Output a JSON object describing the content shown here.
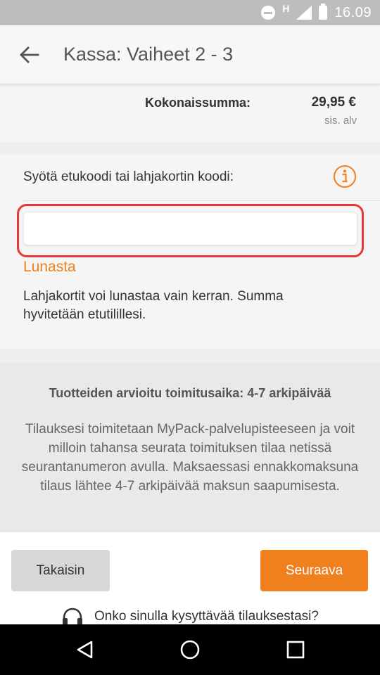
{
  "status_bar": {
    "time": "16.09",
    "network_label": "H",
    "icons": [
      "do-not-disturb-icon",
      "signal-icon",
      "battery-icon"
    ]
  },
  "toolbar": {
    "title": "Kassa: Vaiheet 2 - 3",
    "back_icon": "arrow-left-icon"
  },
  "summary": {
    "total_label": "Kokonaissumma:",
    "total_value": "29,95 €",
    "vat_note": "sis. alv"
  },
  "voucher": {
    "label": "Syötä etukoodi tai lahjakortin koodi:",
    "input_value": "",
    "input_placeholder": "",
    "redeem_label": "Lunasta",
    "note": "Lahjakortit voi lunastaa vain kerran. Summa hyvitetään etutilillesi.",
    "info_icon": "info-icon"
  },
  "delivery": {
    "title": "Tuotteiden arvioitu toimitusaika: 4-7 arkipäivää",
    "text": "Tilauksesi toimitetaan MyPack-palvelupisteeseen ja voit milloin tahansa seurata toimituksen tilaa netissä seurantanumeron avulla. Maksaessasi ennakkomaksuna tilaus lähtee 4-7 arkipäivää maksun saapumisesta."
  },
  "actions": {
    "back_label": "Takaisin",
    "next_label": "Seuraava"
  },
  "help": {
    "text": "Onko sinulla kysyttävää tilauksestasi?",
    "icon": "headset-icon"
  },
  "colors": {
    "accent": "#f07f1e",
    "highlight": "#e53935",
    "status_bar": "#bdbdbd"
  }
}
